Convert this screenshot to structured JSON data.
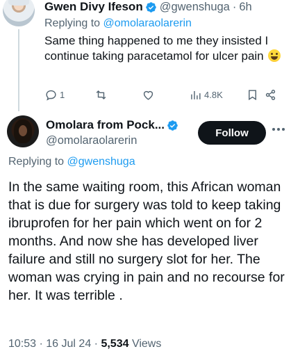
{
  "reply_tweet": {
    "author_name": "Gwen Divy Ifeson",
    "author_handle": "@gwenshuga",
    "time_separator": "·",
    "timestamp": "6h",
    "replying_prefix": "Replying to",
    "replying_to": "@omolaraolarerin",
    "text": "Same thing happened to me they insisted I continue taking paracetamol for ulcer pain",
    "emoji": "grinning-sweat-emoji",
    "reply_count": "1",
    "views_count": "4.8K",
    "icons": [
      "reply-icon",
      "retweet-icon",
      "like-icon",
      "views-icon",
      "bookmark-icon",
      "share-icon"
    ]
  },
  "main_tweet": {
    "author_name": "Omolara from Pock...",
    "author_handle": "@omolaraolarerin",
    "follow_label": "Follow",
    "replying_prefix": "Replying to",
    "replying_to": "@gwenshuga",
    "text": "In the same waiting room, this African woman  that is due for surgery was told to keep taking ibruprofen for her pain which went on for 2 months. And now she has developed liver failure and still no surgery slot for her. The woman was crying in pain and no recourse for her. It was terrible .",
    "time": "10:53",
    "date": "16 Jul 24",
    "separator": "·",
    "views_count": "5,534",
    "views_label": "Views"
  },
  "colors": {
    "text_primary": "#0f1419",
    "text_secondary": "#536471",
    "accent_link": "#1d9bf0",
    "verified_badge": "#1d9bf0",
    "follow_button_bg": "#0f1419",
    "follow_button_text": "#ffffff"
  }
}
